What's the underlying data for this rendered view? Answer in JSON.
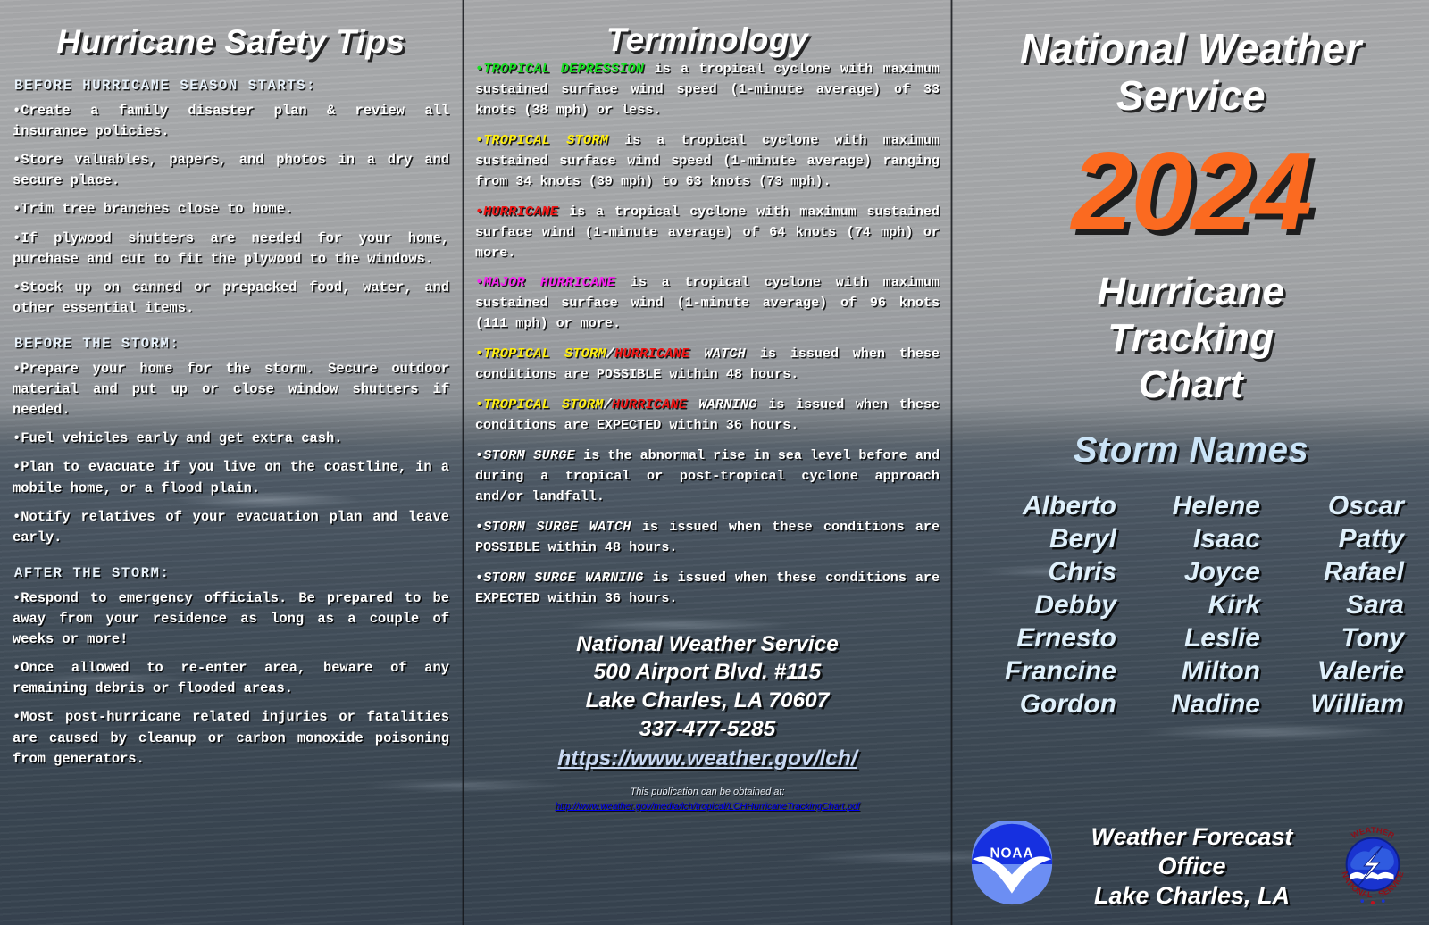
{
  "safety": {
    "title": "Hurricane Safety Tips",
    "sections": [
      {
        "heading": "BEFORE HURRICANE SEASON STARTS:",
        "tips": [
          "Create a family disaster plan & review all insurance policies.",
          "Store valuables, papers, and photos in a dry and secure place.",
          "Trim tree branches close to home.",
          "If plywood shutters are needed for your home, purchase and cut to fit the plywood to the windows.",
          "Stock up on canned or prepacked food, water, and other essential items."
        ]
      },
      {
        "heading": "BEFORE THE STORM:",
        "tips": [
          "Prepare your home for the storm.  Secure outdoor material and put up or close window shutters if needed.",
          "Fuel vehicles early and get extra cash.",
          "Plan to evacuate if you live on the coastline, in a mobile home, or a flood plain.",
          "Notify relatives of your evacuation plan and leave early."
        ]
      },
      {
        "heading": "AFTER THE STORM:",
        "tips": [
          "Respond to emergency officials.  Be prepared to be away from your residence as long as a couple of weeks or more!",
          "Once allowed to re-enter area, beware of any remaining debris or flooded areas.",
          "Most post-hurricane related injuries or fatalities are caused by cleanup or carbon monoxide poisoning from generators."
        ]
      }
    ]
  },
  "terminology": {
    "title": "Terminology",
    "entries": [
      {
        "bullet_color": "green",
        "label_parts": [
          {
            "text": "TROPICAL DEPRESSION",
            "color": "green"
          }
        ],
        "body": " is a tropical cyclone with maximum sustained surface wind speed (1-minute average) of 33 knots (38 mph) or less."
      },
      {
        "bullet_color": "yellow",
        "label_parts": [
          {
            "text": "TROPICAL STORM",
            "color": "yellow"
          }
        ],
        "body": " is a tropical cyclone with maximum sustained surface wind speed (1-minute average) ranging from 34 knots (39 mph) to 63 knots (73 mph)."
      },
      {
        "bullet_color": "red",
        "label_parts": [
          {
            "text": "HURRICANE",
            "color": "red"
          }
        ],
        "body": " is a tropical cyclone with maximum sustained surface wind (1-minute average) of 64 knots (74 mph) or more."
      },
      {
        "bullet_color": "magenta",
        "label_parts": [
          {
            "text": "MAJOR HURRICANE",
            "color": "magenta"
          }
        ],
        "body": " is a tropical cyclone with maximum sustained surface wind (1-minute average) of 96 knots (111 mph) or more."
      },
      {
        "bullet_color": "yellow",
        "label_parts": [
          {
            "text": "TROPICAL STORM",
            "color": "yellow"
          },
          {
            "text": "/",
            "color": "white"
          },
          {
            "text": "HURRICANE",
            "color": "red"
          },
          {
            "text": " WATCH",
            "color": "white"
          }
        ],
        "body": " is issued when these conditions are POSSIBLE within 48 hours."
      },
      {
        "bullet_color": "yellow",
        "label_parts": [
          {
            "text": "TROPICAL STORM",
            "color": "yellow"
          },
          {
            "text": "/",
            "color": "white"
          },
          {
            "text": "HURRICANE",
            "color": "red"
          },
          {
            "text": " WARNING",
            "color": "white"
          }
        ],
        "body": " is issued when these conditions are EXPECTED within 36 hours."
      },
      {
        "bullet_color": "white",
        "label_parts": [
          {
            "text": "STORM SURGE",
            "color": "white"
          }
        ],
        "body": " is the abnormal rise in sea level before and during a tropical or post-tropical cyclone approach and/or landfall."
      },
      {
        "bullet_color": "white",
        "label_parts": [
          {
            "text": "STORM SURGE WATCH",
            "color": "white"
          }
        ],
        "body": " is issued when these conditions are POSSIBLE within 48 hours."
      },
      {
        "bullet_color": "white",
        "label_parts": [
          {
            "text": "STORM SURGE WARNING",
            "color": "white"
          }
        ],
        "body": " is issued when these conditions are EXPECTED within 36 hours."
      }
    ],
    "address": {
      "line1": "National Weather Service",
      "line2": "500 Airport Blvd. #115",
      "line3": "Lake Charles, LA 70607",
      "phone": "337-477-5285",
      "url": "https://www.weather.gov/lch/"
    },
    "fineprint": {
      "intro": "This publication can be obtained at:",
      "url": "http://www.weather.gov/media/lch/tropical/LCHHurricaneTrackingChart.pdf"
    }
  },
  "cover": {
    "agency_line1": "National Weather",
    "agency_line2": "Service",
    "year": "2024",
    "chart_title_line1": "Hurricane",
    "chart_title_line2": "Tracking",
    "chart_title_line3": "Chart",
    "storm_names_heading": "Storm Names",
    "storm_name_columns": [
      [
        "Alberto",
        "Beryl",
        "Chris",
        "Debby",
        "Ernesto",
        "Francine",
        "Gordon"
      ],
      [
        "Helene",
        "Isaac",
        "Joyce",
        "Kirk",
        "Leslie",
        "Milton",
        "Nadine"
      ],
      [
        "Oscar",
        "Patty",
        "Rafael",
        "Sara",
        "Tony",
        "Valerie",
        "William"
      ]
    ],
    "office_line1": "Weather Forecast Office",
    "office_line2": "Lake Charles, LA",
    "noaa_logo_text": "NOAA",
    "nws_seal_text": "NATIONAL WEATHER SERVICE"
  },
  "colors": {
    "tropical_depression": "#19e024",
    "tropical_storm": "#ffef12",
    "hurricane": "#f01414",
    "major_hurricane": "#f526ee",
    "year_accent": "#fb6a20",
    "storm_names_heading": "#cbe4f7"
  }
}
